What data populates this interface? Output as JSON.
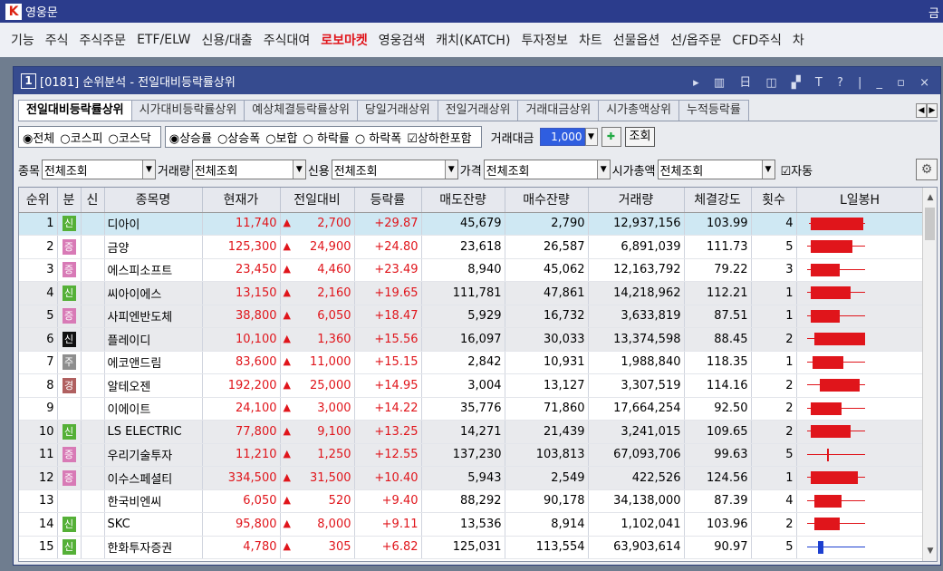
{
  "app": {
    "title": "영웅문",
    "right_text": "금"
  },
  "menu": [
    "기능",
    "주식",
    "주식주문",
    "ETF/ELW",
    "신용/대출",
    "주식대여",
    "로보마켓",
    "영웅검색",
    "캐치(KATCH)",
    "투자정보",
    "차트",
    "선물옵션",
    "선/옵주문",
    "CFD주식",
    "차"
  ],
  "menu_highlight": "로보마켓",
  "window": {
    "num": "1",
    "title": "[0181] 순위분석 - 전일대비등락률상위",
    "controls": "▸ ▥ 日 ◫ ▞ T ? | _ ▫ ×"
  },
  "tabs": [
    "전일대비등락률상위",
    "시가대비등락률상위",
    "예상체결등락률상위",
    "당일거래상위",
    "전일거래상위",
    "거래대금상위",
    "시가총액상위",
    "누적등락률"
  ],
  "filters1": {
    "market": [
      "◉전체",
      "○코스피",
      "○코스닥"
    ],
    "type": [
      "◉상승률",
      "○상승폭",
      "○보합",
      "○ 하락률",
      "○ 하락폭"
    ],
    "limit_check": "☑상하한포함",
    "amount_label": "거래대금",
    "amount_value": "1,000",
    "query_btn": "조회"
  },
  "filters2": {
    "item_label": "종목",
    "item_value": "전체조회",
    "volume_label": "거래량",
    "volume_value": "전체조회",
    "credit_label": "신용",
    "credit_value": "전체조회",
    "price_label": "가격",
    "price_value": "전체조회",
    "cap_label": "시가총액",
    "cap_value": "전체조회",
    "auto": "☑자동"
  },
  "columns": [
    "순위",
    "분",
    "신",
    "종목명",
    "현재가",
    "전일대비",
    "등락률",
    "매도잔량",
    "매수잔량",
    "거래량",
    "체결강도",
    "횟수",
    "L일봉H"
  ],
  "rows": [
    {
      "rank": "1",
      "badge": "신",
      "bc": "b-green",
      "name": "디아이",
      "price": "11,740",
      "diff": "2,700",
      "rate": "+29.87",
      "sell": "45,679",
      "buy": "2,790",
      "vol": "12,937,156",
      "str": "103.99",
      "cnt": "4",
      "cs": 10,
      "ce": 72,
      "bs": 12,
      "be": 70
    },
    {
      "rank": "2",
      "badge": "증",
      "bc": "b-pink",
      "name": "금양",
      "price": "125,300",
      "diff": "24,900",
      "rate": "+24.80",
      "sell": "23,618",
      "buy": "26,587",
      "vol": "6,891,039",
      "str": "111.73",
      "cnt": "5",
      "cs": 8,
      "ce": 72,
      "bs": 12,
      "be": 58
    },
    {
      "rank": "3",
      "badge": "증",
      "bc": "b-pink",
      "name": "에스피소프트",
      "price": "23,450",
      "diff": "4,460",
      "rate": "+23.49",
      "sell": "8,940",
      "buy": "45,062",
      "vol": "12,163,792",
      "str": "79.22",
      "cnt": "3",
      "cs": 8,
      "ce": 72,
      "bs": 12,
      "be": 44
    },
    {
      "rank": "4",
      "badge": "신",
      "bc": "b-green",
      "name": "씨아이에스",
      "price": "13,150",
      "diff": "2,160",
      "rate": "+19.65",
      "sell": "111,781",
      "buy": "47,861",
      "vol": "14,218,962",
      "str": "112.21",
      "cnt": "1",
      "cs": 8,
      "ce": 72,
      "bs": 12,
      "be": 56
    },
    {
      "rank": "5",
      "badge": "증",
      "bc": "b-pink",
      "name": "사피엔반도체",
      "price": "38,800",
      "diff": "6,050",
      "rate": "+18.47",
      "sell": "5,929",
      "buy": "16,732",
      "vol": "3,633,819",
      "str": "87.51",
      "cnt": "1",
      "cs": 8,
      "ce": 72,
      "bs": 12,
      "be": 44
    },
    {
      "rank": "6",
      "badge": "신",
      "bc": "b-black",
      "name": "플레이디",
      "price": "10,100",
      "diff": "1,360",
      "rate": "+15.56",
      "sell": "16,097",
      "buy": "30,033",
      "vol": "13,374,598",
      "str": "88.45",
      "cnt": "2",
      "cs": 8,
      "ce": 72,
      "bs": 16,
      "be": 72
    },
    {
      "rank": "7",
      "badge": "주",
      "bc": "b-gray",
      "name": "에코앤드림",
      "price": "83,600",
      "diff": "11,000",
      "rate": "+15.15",
      "sell": "2,842",
      "buy": "10,931",
      "vol": "1,988,840",
      "str": "118.35",
      "cnt": "1",
      "cs": 8,
      "ce": 72,
      "bs": 14,
      "be": 48
    },
    {
      "rank": "8",
      "badge": "경",
      "bc": "b-brown",
      "name": "알테오젠",
      "price": "192,200",
      "diff": "25,000",
      "rate": "+14.95",
      "sell": "3,004",
      "buy": "13,127",
      "vol": "3,307,519",
      "str": "114.16",
      "cnt": "2",
      "cs": 8,
      "ce": 72,
      "bs": 22,
      "be": 66
    },
    {
      "rank": "9",
      "badge": "",
      "bc": "",
      "name": "이에이트",
      "price": "24,100",
      "diff": "3,000",
      "rate": "+14.22",
      "sell": "35,776",
      "buy": "71,860",
      "vol": "17,664,254",
      "str": "92.50",
      "cnt": "2",
      "cs": 8,
      "ce": 72,
      "bs": 12,
      "be": 46
    },
    {
      "rank": "10",
      "badge": "신",
      "bc": "b-green",
      "name": "LS ELECTRIC",
      "price": "77,800",
      "diff": "9,100",
      "rate": "+13.25",
      "sell": "14,271",
      "buy": "21,439",
      "vol": "3,241,015",
      "str": "109.65",
      "cnt": "2",
      "cs": 8,
      "ce": 72,
      "bs": 12,
      "be": 56
    },
    {
      "rank": "11",
      "badge": "증",
      "bc": "b-pink",
      "name": "우리기술투자",
      "price": "11,210",
      "diff": "1,250",
      "rate": "+12.55",
      "sell": "137,230",
      "buy": "103,813",
      "vol": "67,093,706",
      "str": "99.63",
      "cnt": "5",
      "cs": 8,
      "ce": 72,
      "bs": 30,
      "be": 32
    },
    {
      "rank": "12",
      "badge": "증",
      "bc": "b-pink",
      "name": "이수스페셜티",
      "price": "334,500",
      "diff": "31,500",
      "rate": "+10.40",
      "sell": "5,943",
      "buy": "2,549",
      "vol": "422,526",
      "str": "124.56",
      "cnt": "1",
      "cs": 8,
      "ce": 72,
      "bs": 12,
      "be": 64
    },
    {
      "rank": "13",
      "badge": "",
      "bc": "",
      "name": "한국비엔씨",
      "price": "6,050",
      "diff": "520",
      "rate": "+9.40",
      "sell": "88,292",
      "buy": "90,178",
      "vol": "34,138,000",
      "str": "87.39",
      "cnt": "4",
      "cs": 8,
      "ce": 72,
      "bs": 16,
      "be": 46
    },
    {
      "rank": "14",
      "badge": "신",
      "bc": "b-green",
      "name": "SKC",
      "price": "95,800",
      "diff": "8,000",
      "rate": "+9.11",
      "sell": "13,536",
      "buy": "8,914",
      "vol": "1,102,041",
      "str": "103.96",
      "cnt": "2",
      "cs": 8,
      "ce": 72,
      "bs": 16,
      "be": 44
    },
    {
      "rank": "15",
      "badge": "신",
      "bc": "b-green",
      "name": "한화투자증권",
      "price": "4,780",
      "diff": "305",
      "rate": "+6.82",
      "sell": "125,031",
      "buy": "113,554",
      "vol": "63,903,614",
      "str": "90.97",
      "cnt": "5",
      "cs": 8,
      "ce": 72,
      "bs": 22,
      "be": 28,
      "blue": true
    }
  ],
  "colors": {
    "red": "#e0151b",
    "blue": "#1c3fd0",
    "title": "#2b3c8c"
  },
  "icons": [
    "logo-icon",
    "up-arrow-icon",
    "gear-icon",
    "scroll-up-icon",
    "scroll-down-icon"
  ]
}
